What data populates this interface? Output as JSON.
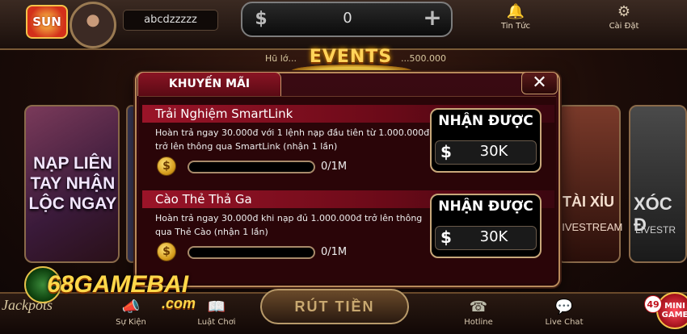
{
  "topbar": {
    "logo_text": "SUN",
    "username": "abcdzzzzz",
    "balance": "0",
    "news_label": "Tin Tức",
    "settings_label": "Cài Đặt",
    "news_icon": "bell-icon",
    "settings_icon": "gear-icon"
  },
  "jackpot": {
    "text": "Hũ lớ...",
    "value": "...500.000"
  },
  "events_title": "EVENTS",
  "cards": {
    "nap_text": "NẠP LIÊN TAY NHẬN LỘC NGAY",
    "taixiu_text": "TÀI XỈU",
    "taixiu_sub": "LIVESTREAM",
    "xocdia_text": "XÓC Đ",
    "xocdia_sub": "LIVESTR"
  },
  "dialog": {
    "tab_label": "KHUYẾN MÃI",
    "close_icon": "close-icon",
    "promos": [
      {
        "title": "Trải Nghiệm SmartLink",
        "description": "Hoàn trả ngay 30.000đ với 1 lệnh nạp đầu tiên từ 1.000.000đ trở lên thông qua SmartLink (nhận 1 lần)",
        "progress_text": "0/1M",
        "progress": 0,
        "reward_label": "NHẬN ĐƯỢC",
        "reward_currency": "$",
        "reward_amount": "30K"
      },
      {
        "title": "Cào Thẻ Thả Ga",
        "description": "Hoàn trả ngay 30.000đ khi nạp đủ 1.000.000đ trở lên thông qua Thẻ Cào (nhận 1 lần)",
        "progress_text": "0/1M",
        "progress": 0,
        "reward_label": "NHẬN ĐƯỢC",
        "reward_currency": "$",
        "reward_amount": "30K"
      }
    ]
  },
  "bottombar": {
    "items": [
      {
        "label": "Sự Kiện",
        "icon": "megaphone-icon"
      },
      {
        "label": "Luật Chơi",
        "icon": "book-icon"
      },
      {
        "label": "Hotline",
        "icon": "phone-icon"
      },
      {
        "label": "Live Chat",
        "icon": "chat-icon"
      }
    ],
    "withdraw_label": "RÚT TIỀN",
    "brand_text": "68GAMEBAI",
    "brand_sub": ".com",
    "jackpots_text": "Jackpots",
    "mini_badge": "49",
    "mini_game_label": "MINI GAME"
  },
  "colors": {
    "accent_gold": "#ffd45a",
    "dialog_red": "#9a1428",
    "progress_fill": "#e6b83a"
  }
}
